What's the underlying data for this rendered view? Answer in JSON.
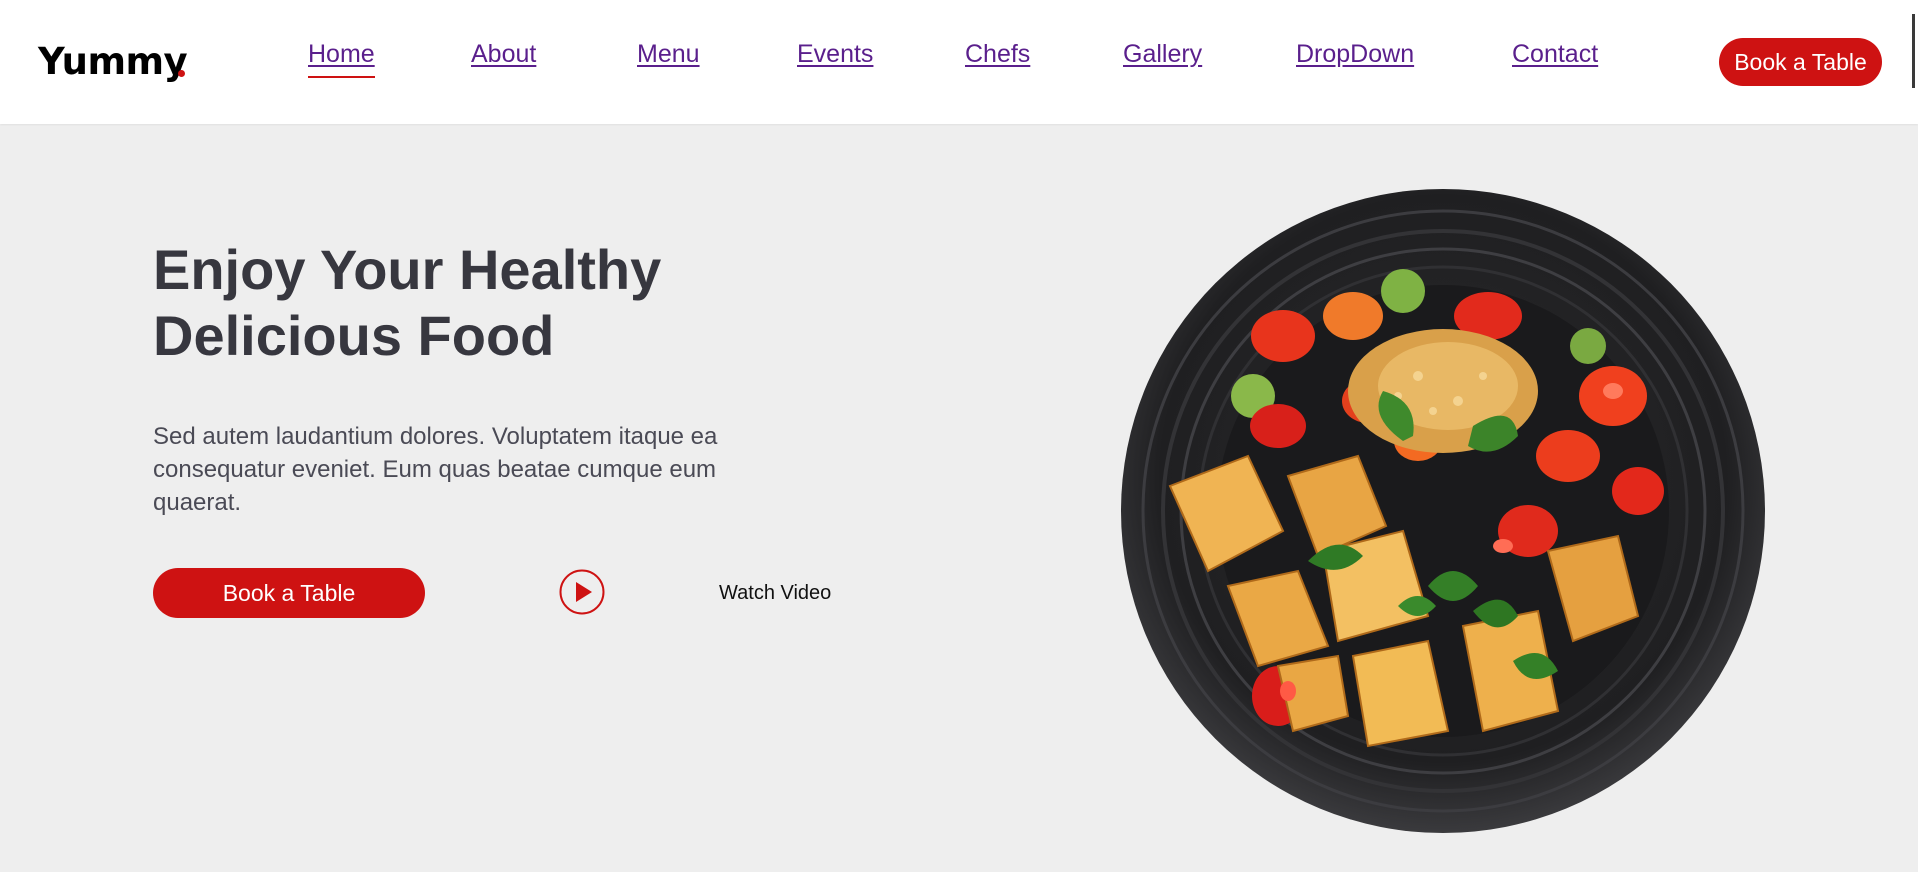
{
  "header": {
    "logo": "Yummy",
    "nav": [
      "Home",
      "About",
      "Menu",
      "Events",
      "Chefs",
      "Gallery",
      "DropDown",
      "Contact"
    ],
    "cta_label": "Book a Table"
  },
  "hero": {
    "title_line1": "Enjoy Your Healthy",
    "title_line2": "Delicious Food",
    "description": "Sed autem laudantium dolores. Voluptatem itaque ea consequatur eveniet. Eum quas beatae cumque eum quaerat.",
    "cta_label": "Book a Table",
    "video_label": "Watch Video"
  },
  "icons": {
    "play": "play-circle-icon",
    "dish": "food-plate-image"
  },
  "colors": {
    "accent": "#ce1212",
    "nav_link": "#5a1f8c",
    "heading": "#37373f",
    "background": "#eeeeee"
  }
}
